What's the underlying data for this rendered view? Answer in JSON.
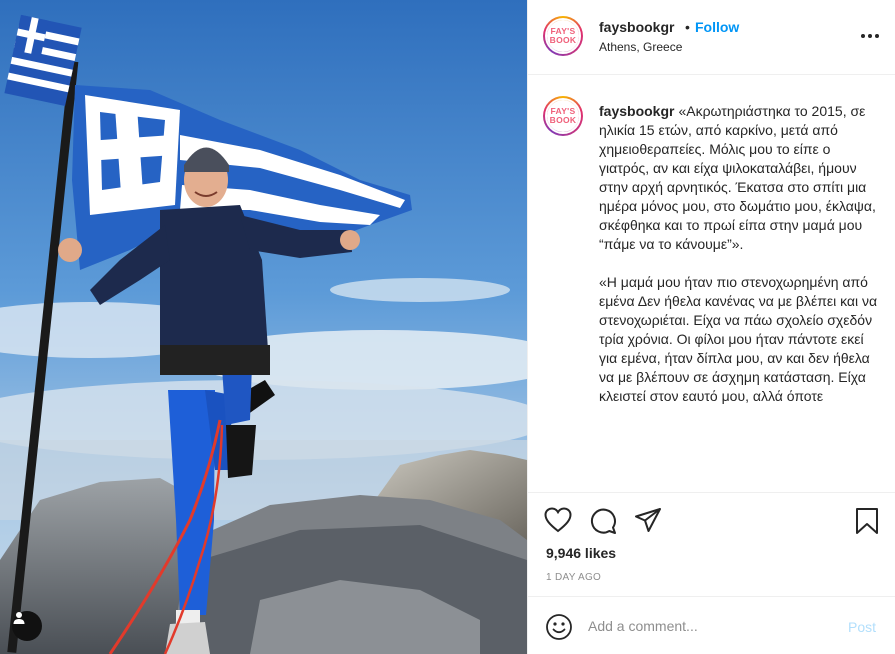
{
  "post": {
    "author": "faysbookgr",
    "follow_label": "Follow",
    "separator": "•",
    "location": "Athens, Greece",
    "avatar_logo_lines": [
      "FAY'S",
      "BOOK"
    ],
    "caption": "«Ακρωτηριάστηκα το 2015, σε ηλικία 15 ετών, από καρκίνο, μετά από χημειοθεραπείες. Μόλις μου το είπε ο γιατρός, αν και είχα ψιλοκαταλάβει, ήμουν στην αρχή αρνητικός. Έκατσα στο σπίτι μια ημέρα μόνος μου, στο δωμάτιο μου, έκλαψα, σκέφθηκα και το πρωί είπα στην μαμά μου “πάμε να το κάνουμε”».\n\n«Η μαμά μου ήταν πιο στενοχωρημένη από εμένα Δεν ήθελα κανένας να με βλέπει και να στενοχωριέται. Είχα να πάω σχολείο σχεδόν τρία χρόνια. Οι φίλοι μου ήταν πάντοτε εκεί για εμένα, ήταν δίπλα μου, αν και δεν ήθελα να με βλέπουν σε άσχημη κατάσταση. Είχα κλειστεί στον εαυτό μου, αλλά όποτε",
    "likes": "9,946 likes",
    "timestamp": "1 DAY AGO"
  },
  "comment_box": {
    "placeholder": "Add a comment...",
    "post_label": "Post"
  },
  "icons": {
    "like": "heart-icon",
    "comment": "comment-bubble-icon",
    "share": "paper-plane-icon",
    "save": "bookmark-icon",
    "emoji": "smiley-icon",
    "options": "more-horizontal-icon",
    "tags": "user-tag-icon"
  },
  "colors": {
    "follow": "#0095f6",
    "post_disabled": "#b2dffc",
    "muted": "#8e8e8e",
    "text": "#262626"
  }
}
